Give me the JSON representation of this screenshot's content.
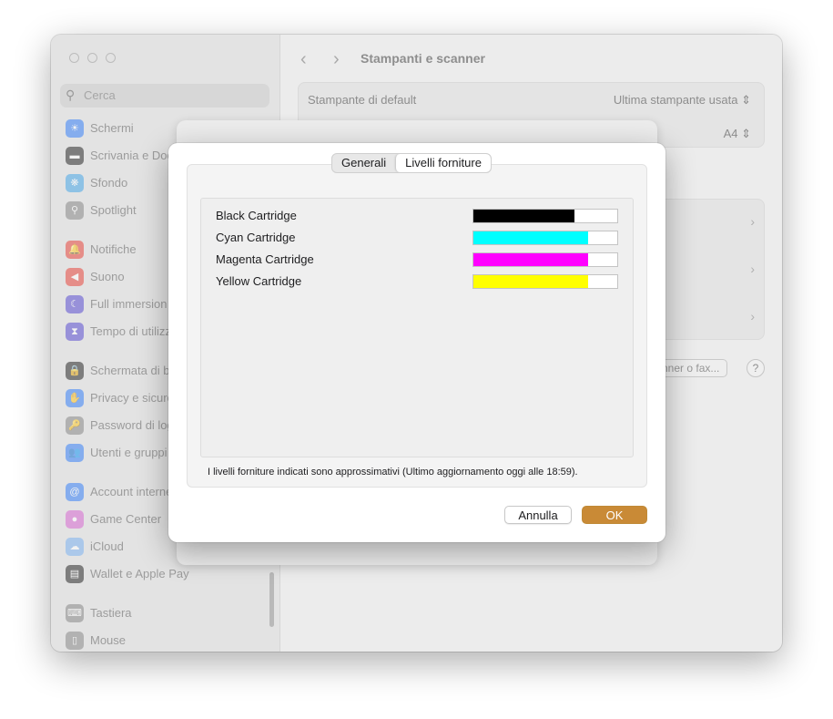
{
  "window": {
    "title": "Stampanti e scanner",
    "back_icon": "‹",
    "forward_icon": "›"
  },
  "sidebar": {
    "search_placeholder": "Cerca",
    "items": [
      {
        "label": "Schermi",
        "icon": "display-icon",
        "color": "#3a82f7",
        "glyph": "☀"
      },
      {
        "label": "Scrivania e Dock",
        "icon": "dock-icon",
        "color": "#2b2b2b",
        "glyph": "▬"
      },
      {
        "label": "Sfondo",
        "icon": "wallpaper-icon",
        "color": "#4aa8e8",
        "glyph": "❋"
      },
      {
        "label": "Spotlight",
        "icon": "spotlight-icon",
        "color": "#8a8a8a",
        "glyph": "⚲"
      },
      {
        "label": "Notifiche",
        "icon": "notifications-icon",
        "color": "#e8483f",
        "glyph": "🔔"
      },
      {
        "label": "Suono",
        "icon": "sound-icon",
        "color": "#e8483f",
        "glyph": "◀"
      },
      {
        "label": "Full immersion",
        "icon": "focus-icon",
        "color": "#5b4fd1",
        "glyph": "☾"
      },
      {
        "label": "Tempo di utilizzo",
        "icon": "screen-time-icon",
        "color": "#5b4fd1",
        "glyph": "⧗"
      },
      {
        "label": "Schermata di blocco",
        "icon": "lock-screen-icon",
        "color": "#2b2b2b",
        "glyph": "🔒"
      },
      {
        "label": "Privacy e sicurezza",
        "icon": "privacy-icon",
        "color": "#3a82f7",
        "glyph": "✋"
      },
      {
        "label": "Password di login",
        "icon": "password-icon",
        "color": "#8a8a8a",
        "glyph": "🔑"
      },
      {
        "label": "Utenti e gruppi",
        "icon": "users-icon",
        "color": "#3a82f7",
        "glyph": "👥"
      },
      {
        "label": "Account internet",
        "icon": "internet-accounts-icon",
        "color": "#3a82f7",
        "glyph": "@"
      },
      {
        "label": "Game Center",
        "icon": "game-center-icon",
        "color": "#d86ad1",
        "glyph": "●"
      },
      {
        "label": "iCloud",
        "icon": "icloud-icon",
        "color": "#7fb3f0",
        "glyph": "☁"
      },
      {
        "label": "Wallet e Apple Pay",
        "icon": "wallet-icon",
        "color": "#2b2b2b",
        "glyph": "▤"
      },
      {
        "label": "Tastiera",
        "icon": "keyboard-icon",
        "color": "#8a8a8a",
        "glyph": "⌨"
      },
      {
        "label": "Mouse",
        "icon": "mouse-icon",
        "color": "#8a8a8a",
        "glyph": "▯"
      }
    ]
  },
  "main": {
    "default_printer_label": "Stampante di default",
    "default_printer_value": "Ultima stampante usata",
    "paper_size_value": "A4",
    "add_button_label": "nner o fax...",
    "help_label": "?"
  },
  "dialog": {
    "tabs": [
      "Generali",
      "Livelli forniture"
    ],
    "selected_tab": 1,
    "supplies": [
      {
        "name": "Black Cartridge",
        "level": 0.7,
        "color": "#000000"
      },
      {
        "name": "Cyan Cartridge",
        "level": 0.8,
        "color": "#00ffff"
      },
      {
        "name": "Magenta Cartridge",
        "level": 0.8,
        "color": "#ff00ff"
      },
      {
        "name": "Yellow Cartridge",
        "level": 0.8,
        "color": "#ffff00"
      }
    ],
    "note": "I livelli forniture indicati sono approssimativi (Ultimo aggiornamento oggi alle 18:59).",
    "cancel_label": "Annulla",
    "ok_label": "OK",
    "ok_color": "#c98a36"
  }
}
